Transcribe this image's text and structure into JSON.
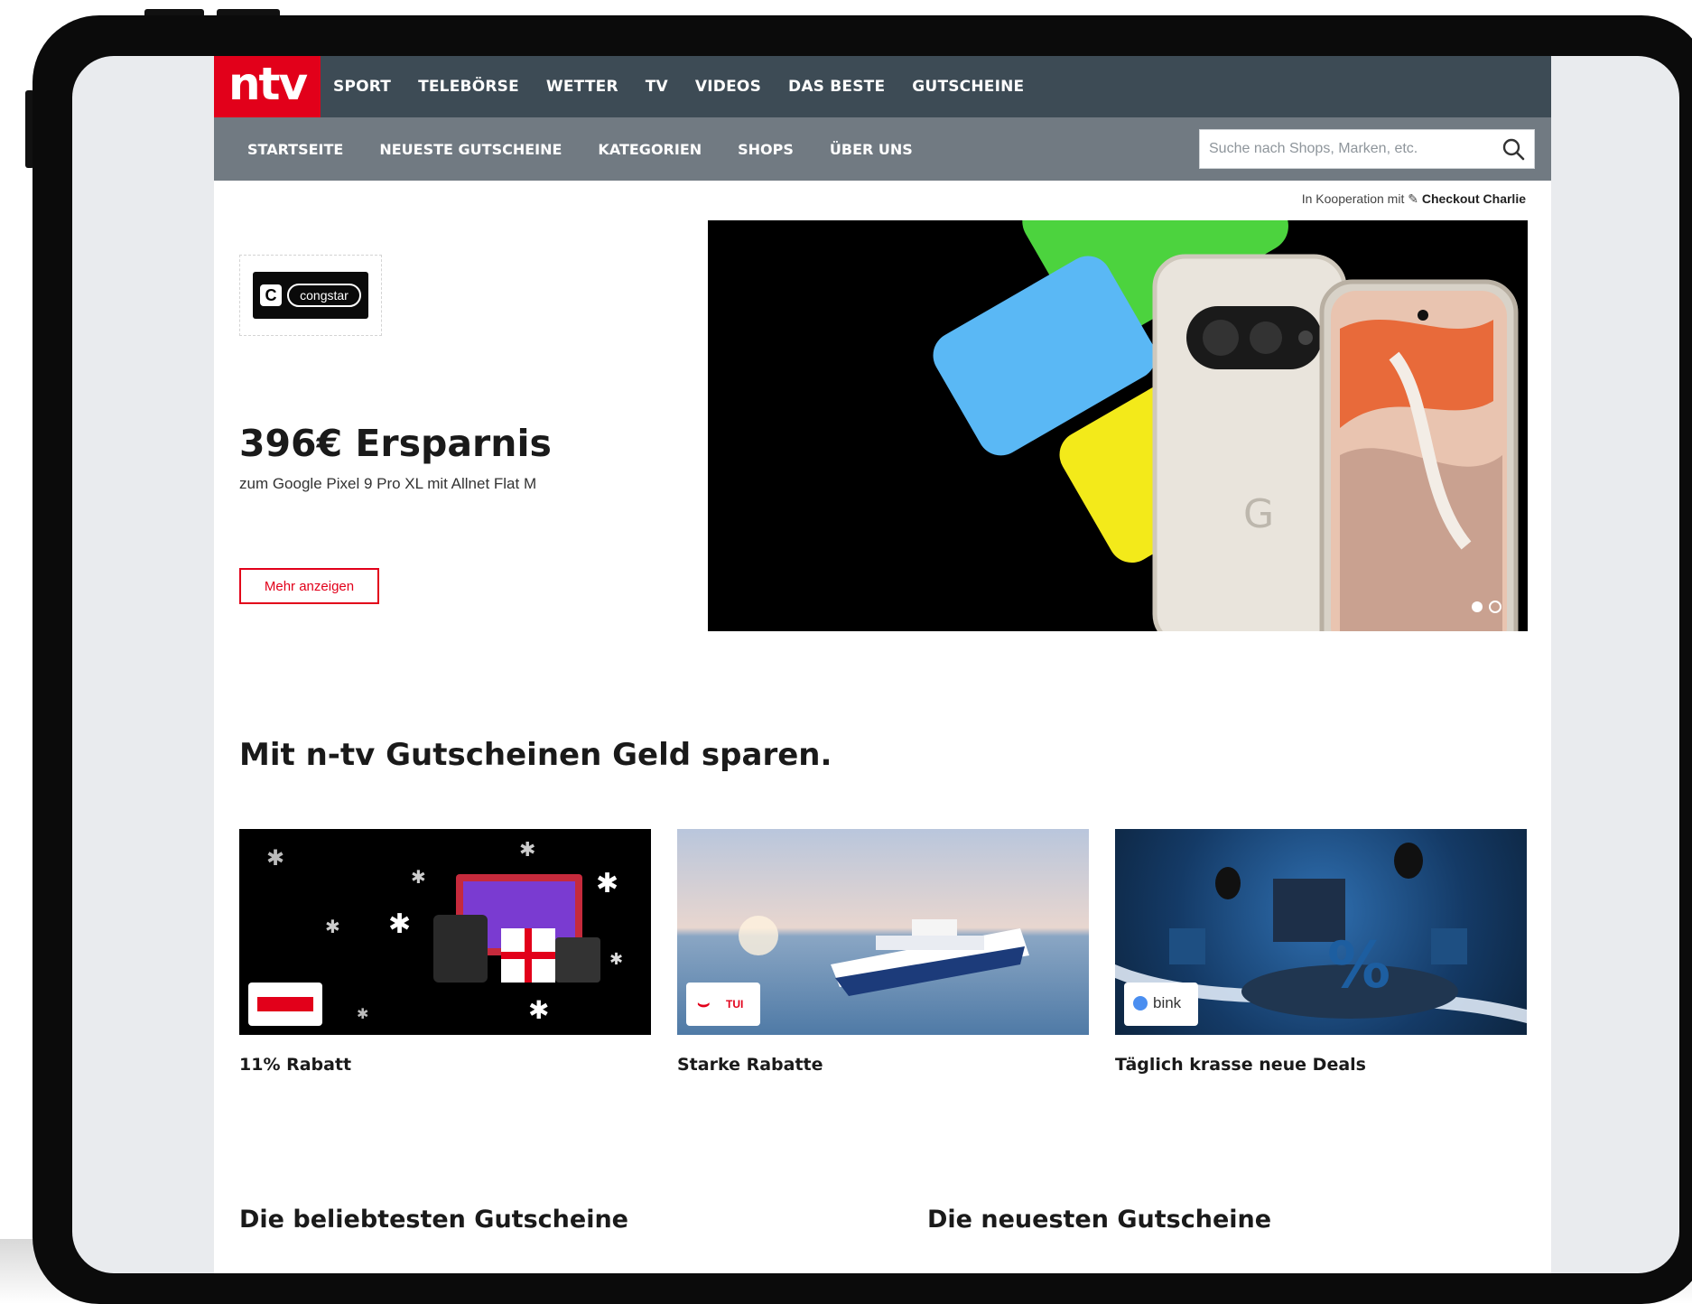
{
  "brand": {
    "logo": "ntv",
    "accent": "#e2001a",
    "topbar_color": "#3d4b55",
    "subbar_color": "#717a82"
  },
  "topnav": [
    "SPORT",
    "TELEBÖRSE",
    "WETTER",
    "TV",
    "VIDEOS",
    "DAS BESTE",
    "GUTSCHEINE"
  ],
  "subnav": [
    "STARTSEITE",
    "NEUESTE GUTSCHEINE",
    "KATEGORIEN",
    "SHOPS",
    "ÜBER UNS"
  ],
  "search": {
    "placeholder": "Suche nach Shops, Marken, etc.",
    "icon": "search-icon"
  },
  "cooperation": {
    "prefix": "In Kooperation mit",
    "partner": "Checkout Charlie"
  },
  "hero": {
    "shop": "congstar",
    "title": "396€ Ersparnis",
    "subtitle": "zum Google Pixel 9 Pro XL mit Allnet Flat M",
    "button": "Mehr anzeigen",
    "slides_total": 2,
    "active_slide": 1
  },
  "section_title": "Mit n-tv Gutscheinen Geld sparen.",
  "cards": [
    {
      "label": "11% Rabatt"
    },
    {
      "label": "Starke Rabatte",
      "badge": "TUI"
    },
    {
      "label": "Täglich krasse neue Deals",
      "badge": "bink"
    }
  ],
  "columns": {
    "popular": "Die beliebtesten Gutscheine",
    "newest": "Die neuesten Gutscheine"
  }
}
